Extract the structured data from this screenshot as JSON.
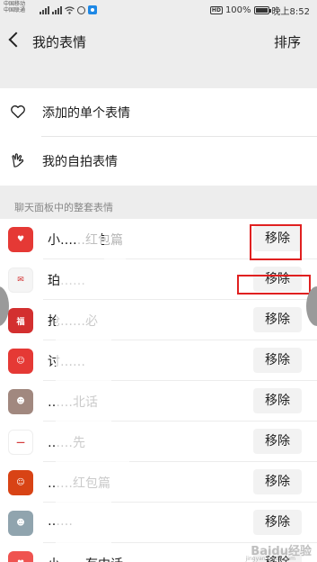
{
  "status_bar": {
    "carrier_lines": [
      "中国移动",
      "中国联通"
    ],
    "network_badges": [
      "4G",
      "4G"
    ],
    "hd": "HD",
    "battery": "100%",
    "battery_level": 1.0,
    "time": "晚上8:52"
  },
  "nav": {
    "title": "我的表情",
    "action": "排序"
  },
  "menu": [
    {
      "label": "添加的单个表情",
      "icon": "heart-icon"
    },
    {
      "label": "我的自拍表情",
      "icon": "hand-gesture-icon"
    }
  ],
  "section_label": "聊天面板中的整套表情",
  "packs": [
    {
      "name": "小……红包篇",
      "button": "移除",
      "avatar_color": "#e53935",
      "avatar_text": "♥"
    },
    {
      "name": "珀……",
      "button": "移除",
      "avatar_color": "#f5f5f5",
      "avatar_text": "✉"
    },
    {
      "name": "抢……必",
      "button": "移除",
      "avatar_color": "#d32f2f",
      "avatar_text": "福"
    },
    {
      "name": "讨……",
      "button": "移除",
      "avatar_color": "#e53935",
      "avatar_text": "☺"
    },
    {
      "name": "……北话",
      "button": "移除",
      "avatar_color": "#a1887f",
      "avatar_text": "☻"
    },
    {
      "name": "……先",
      "button": "移除",
      "avatar_color": "#ffffff",
      "avatar_text": "一"
    },
    {
      "name": "……红包篇",
      "button": "移除",
      "avatar_color": "#d84315",
      "avatar_text": "☺"
    },
    {
      "name": "……",
      "button": "移除",
      "avatar_color": "#90a4ae",
      "avatar_text": "☻"
    },
    {
      "name": "小……有中话",
      "button": "移除",
      "avatar_color": "#ef5350",
      "avatar_text": "♥"
    }
  ],
  "watermark": {
    "main": "Baidu经验",
    "sub": "jingyan.baidu.com"
  }
}
